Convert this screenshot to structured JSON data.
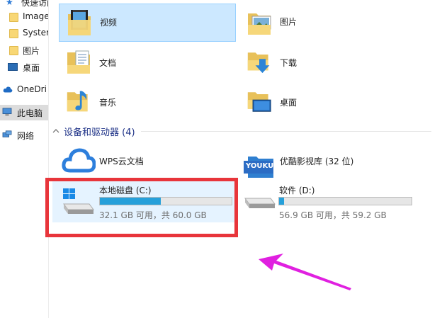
{
  "nav": {
    "items": [
      {
        "label": "快速访问",
        "icon": "star-icon"
      },
      {
        "label": "Image",
        "icon": "folder-icon"
      },
      {
        "label": "Syster",
        "icon": "folder-icon"
      },
      {
        "label": "图片",
        "icon": "folder-icon"
      },
      {
        "label": "桌面",
        "icon": "desktop-icon"
      },
      {
        "label": "OneDri",
        "icon": "cloud-icon"
      },
      {
        "label": "此电脑",
        "icon": "computer-icon"
      },
      {
        "label": "网络",
        "icon": "network-icon"
      }
    ]
  },
  "folders": [
    {
      "label": "视频",
      "icon": "video-folder-icon"
    },
    {
      "label": "图片",
      "icon": "pictures-folder-icon"
    },
    {
      "label": "文档",
      "icon": "documents-folder-icon"
    },
    {
      "label": "下载",
      "icon": "downloads-folder-icon"
    },
    {
      "label": "音乐",
      "icon": "music-folder-icon"
    },
    {
      "label": "桌面",
      "icon": "desktop-folder-icon"
    }
  ],
  "devices_section": {
    "title": "设备和驱动器 (4)"
  },
  "apps": [
    {
      "label": "WPS云文档",
      "icon": "wps-cloud-icon"
    },
    {
      "label": "优酷影视库 (32 位)",
      "icon": "youku-icon",
      "logo_text": "YOUKU"
    }
  ],
  "drives": [
    {
      "name": "本地磁盘 (C:)",
      "free_text": "32.1 GB 可用，共 60.0 GB",
      "used_fraction": 0.465
    },
    {
      "name": "软件 (D:)",
      "free_text": "56.9 GB 可用，共 59.2 GB",
      "used_fraction": 0.039
    }
  ],
  "colors": {
    "highlight_box": "#e8353b",
    "arrow": "#e020e0",
    "drive_fill": "#26a0da",
    "section_header": "#1e3287"
  }
}
